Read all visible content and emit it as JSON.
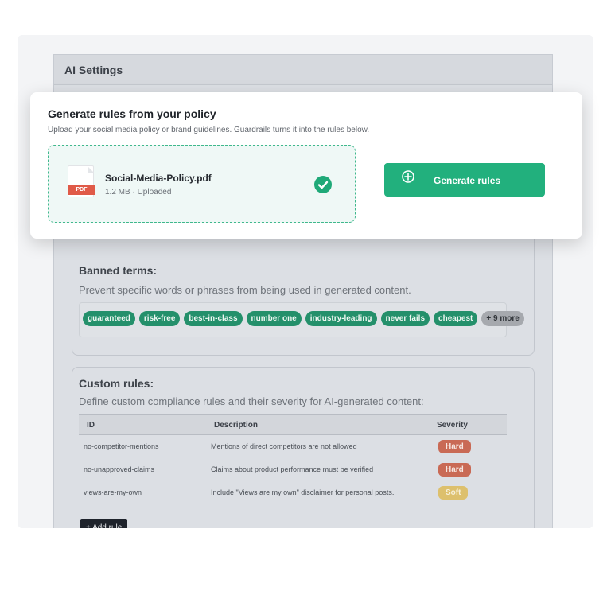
{
  "settings": {
    "title": "AI Settings"
  },
  "banned": {
    "title": "Banned terms:",
    "description": "Prevent specific words or phrases from being used in generated content.",
    "chips": [
      "guaranteed",
      "risk-free",
      "best-in-class",
      "number one",
      "industry-leading",
      "never fails",
      "cheapest"
    ],
    "more": "+ 9 more"
  },
  "custom": {
    "title": "Custom rules:",
    "description": "Define custom compliance rules and their severity for AI-generated content:",
    "columns": {
      "id": "ID",
      "description": "Description",
      "severity": "Severity"
    },
    "rows": [
      {
        "id": "no-competitor-mentions",
        "description": "Mentions of direct competitors are not allowed",
        "severity": "Hard"
      },
      {
        "id": "no-unapproved-claims",
        "description": "Claims about product performance must be verified",
        "severity": "Hard"
      },
      {
        "id": "views-are-my-own",
        "description": "Include \"Views are my own\" disclaimer for personal posts.",
        "severity": "Soft"
      }
    ],
    "add_label": "+ Add rule"
  },
  "modal": {
    "title": "Generate rules from your policy",
    "subtitle": "Upload your social media policy or brand guidelines. Guardrails turns it into the rules below.",
    "file": {
      "badge": "PDF",
      "name": "Social-Media-Policy.pdf",
      "meta": "1.2 MB · Uploaded"
    },
    "generate_label": "Generate rules"
  },
  "colors": {
    "accent": "#22b07d",
    "chip": "#24906b",
    "hard": "#c96a55",
    "soft": "#ddc06d"
  },
  "icons": {
    "file": "pdf-file-icon",
    "uploaded": "check-circle-icon",
    "generate": "plus-circle-icon"
  }
}
